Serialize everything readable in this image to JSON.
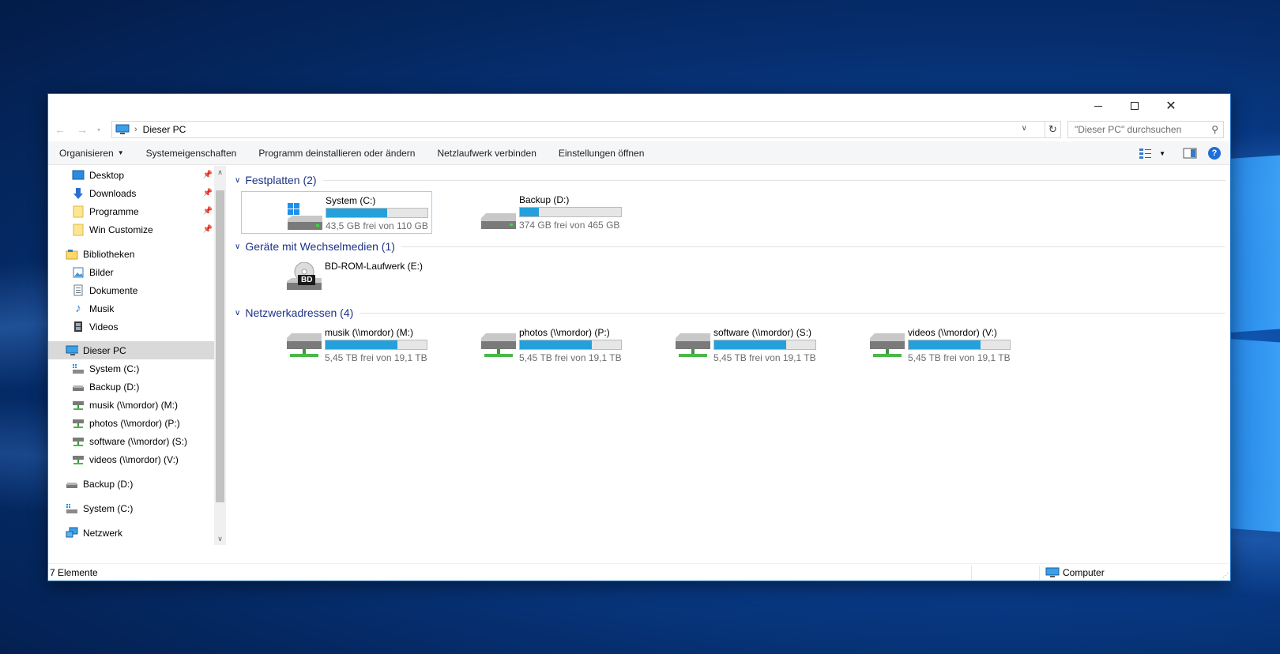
{
  "window": {
    "path": "Dieser PC",
    "search_placeholder": "\"Dieser PC\" durchsuchen"
  },
  "toolbar": {
    "organize": "Organisieren",
    "system_properties": "Systemeigenschaften",
    "uninstall": "Programm deinstallieren oder ändern",
    "map_drive": "Netzlaufwerk verbinden",
    "settings": "Einstellungen öffnen",
    "help": "?"
  },
  "sidebar": {
    "quick": [
      "Desktop",
      "Downloads",
      "Programme",
      "Win Customize"
    ],
    "libraries": "Bibliotheken",
    "library_items": [
      "Bilder",
      "Dokumente",
      "Musik",
      "Videos"
    ],
    "this_pc": "Dieser PC",
    "pc_items": [
      "System (C:)",
      "Backup (D:)",
      "musik (\\\\mordor) (M:)",
      "photos (\\\\mordor) (P:)",
      "software (\\\\mordor) (S:)",
      "videos (\\\\mordor) (V:)"
    ],
    "backup": "Backup (D:)",
    "system": "System (C:)",
    "network": "Netzwerk"
  },
  "groups": {
    "hard_drives": "Festplatten (2)",
    "removable": "Geräte mit Wechselmedien (1)",
    "network": "Netzwerkadressen (4)"
  },
  "drives": [
    {
      "name": "System (C:)",
      "free": "43,5 GB frei von 110 GB",
      "used_fraction": 0.6
    },
    {
      "name": "Backup (D:)",
      "free": "374 GB frei von 465 GB",
      "used_fraction": 0.19
    }
  ],
  "removable": [
    {
      "name": "BD-ROM-Laufwerk (E:)",
      "badge": "BD"
    }
  ],
  "network_drives": [
    {
      "name": "musik (\\\\mordor) (M:)",
      "free": "5,45 TB frei von 19,1 TB",
      "used_fraction": 0.71
    },
    {
      "name": "photos (\\\\mordor) (P:)",
      "free": "5,45 TB frei von 19,1 TB",
      "used_fraction": 0.71
    },
    {
      "name": "software (\\\\mordor) (S:)",
      "free": "5,45 TB frei von 19,1 TB",
      "used_fraction": 0.71
    },
    {
      "name": "videos (\\\\mordor) (V:)",
      "free": "5,45 TB frei von 19,1 TB",
      "used_fraction": 0.71
    }
  ],
  "status": {
    "count": "7 Elemente",
    "location": "Computer"
  }
}
